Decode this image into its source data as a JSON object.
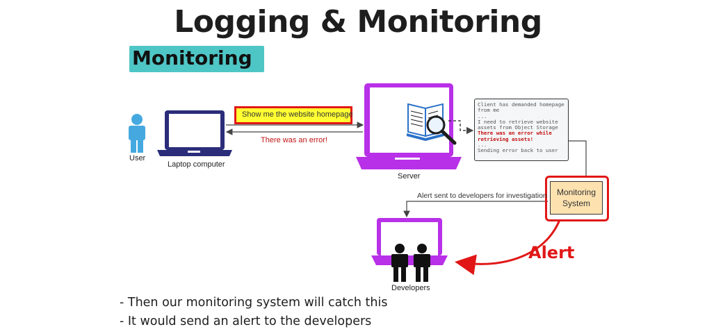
{
  "title": "Logging & Monitoring",
  "section_badge": "Monitoring",
  "nodes": {
    "user": "User",
    "laptop": "Laptop computer",
    "server": "Server",
    "monitoring_line1": "Monitoring",
    "monitoring_line2": "System",
    "developers": "Developers"
  },
  "messages": {
    "request": "Show me the website homepage",
    "error": "There was an error!",
    "alert_sent": "Alert sent to developers for investigation",
    "alert": "Alert"
  },
  "server_log": [
    "Client has demanded homepage",
    "from me",
    "...",
    "I need to retrieve website",
    "assets from Object Storage",
    "",
    "There was an error while",
    "retrieving assets!",
    "...",
    "Sending error back to user"
  ],
  "bullets": [
    "-  Then our monitoring system will catch this",
    "-  It would send an alert to the developers"
  ],
  "colors": {
    "badge": "#4fc6c6",
    "laptop_user": "#2b2d7a",
    "laptop_purple": "#b830e8",
    "user_icon": "#45a9e0",
    "alert_red": "#e11717",
    "monitoring_fill": "#fde2b0"
  }
}
